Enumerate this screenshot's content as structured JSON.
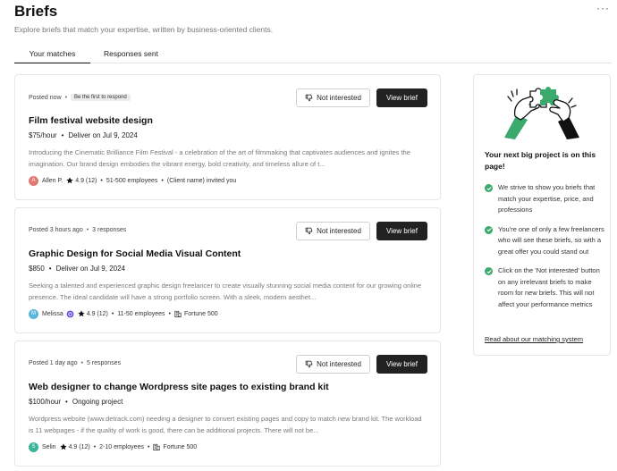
{
  "header": {
    "title": "Briefs",
    "subtitle": "Explore briefs that match your expertise, written by business-oriented clients.",
    "more_label": "···"
  },
  "tabs": [
    {
      "label": "Your matches",
      "active": true
    },
    {
      "label": "Responses sent",
      "active": false
    }
  ],
  "buttons": {
    "not_interested": "Not interested",
    "view_brief": "View brief"
  },
  "briefs": [
    {
      "posted": "Posted now",
      "badge": "Be the first to respond",
      "responses": "",
      "title": "Film festival website design",
      "rate": "$75/hour",
      "deadline": "Deliver on Jul 9, 2024",
      "description": "Introducing the Cinematic Brilliance Film Festival - a celebration of the art of filmmaking that captivates audiences and ignites the imagination. Our brand design embodies the vibrant energy, bold creativity, and timeless allure of t...",
      "client": {
        "initial": "A",
        "name": "Allen P.",
        "avatar_color": "#e07a72",
        "rating": "4.9 (12)",
        "size": "51-500 employees",
        "extra": "(Client name) invited you"
      }
    },
    {
      "posted": "Posted 3 hours ago",
      "badge": "",
      "responses": "3 responses",
      "title": "Graphic Design for Social Media Visual Content",
      "rate": "$850",
      "deadline": "Deliver on Jul 9, 2024",
      "description": "Seeking a talented and experienced graphic design freelancer to create visually stunning social media content for our growing online presence. The ideal candidate will have a strong portfolio screen. With a sleek, modern aesthet...",
      "client": {
        "initial": "M",
        "name": "Melissa",
        "avatar_color": "#5bb6d9",
        "rating": "4.9 (12)",
        "size": "11-50 employees",
        "extra": "Fortune 500"
      }
    },
    {
      "posted": "Posted 1 day ago",
      "badge": "",
      "responses": "5 responses",
      "title": "Web designer to change Wordpress site pages to existing brand kit",
      "rate": "$100/hour",
      "deadline": "Ongoing project",
      "description": "Wordpress website (www.detrack.com) needing a designer to convert existing pages and copy to match new brand kit. The workload is 11 webpages - if the quality of work is good, there can be additional projects. There will not be...",
      "client": {
        "initial": "S",
        "name": "Selin",
        "avatar_color": "#3bb59a",
        "rating": "4.9 (12)",
        "size": "2-10 employees",
        "extra": "Fortune 500"
      }
    }
  ],
  "sidebar": {
    "title": "Your next big project is on this page!",
    "points": [
      "We strive to show you briefs that match your expertise, price, and professions",
      "You're one of only a few freelancers who will see these briefs, so with a great offer you could stand out",
      "Click on the 'Not interested' button on any irrelevant briefs to make room for new briefs. This will not affect your performance metrics"
    ],
    "link": "Read about our matching system"
  },
  "colors": {
    "accent_green": "#3aa96b",
    "dark_button": "#222222"
  }
}
